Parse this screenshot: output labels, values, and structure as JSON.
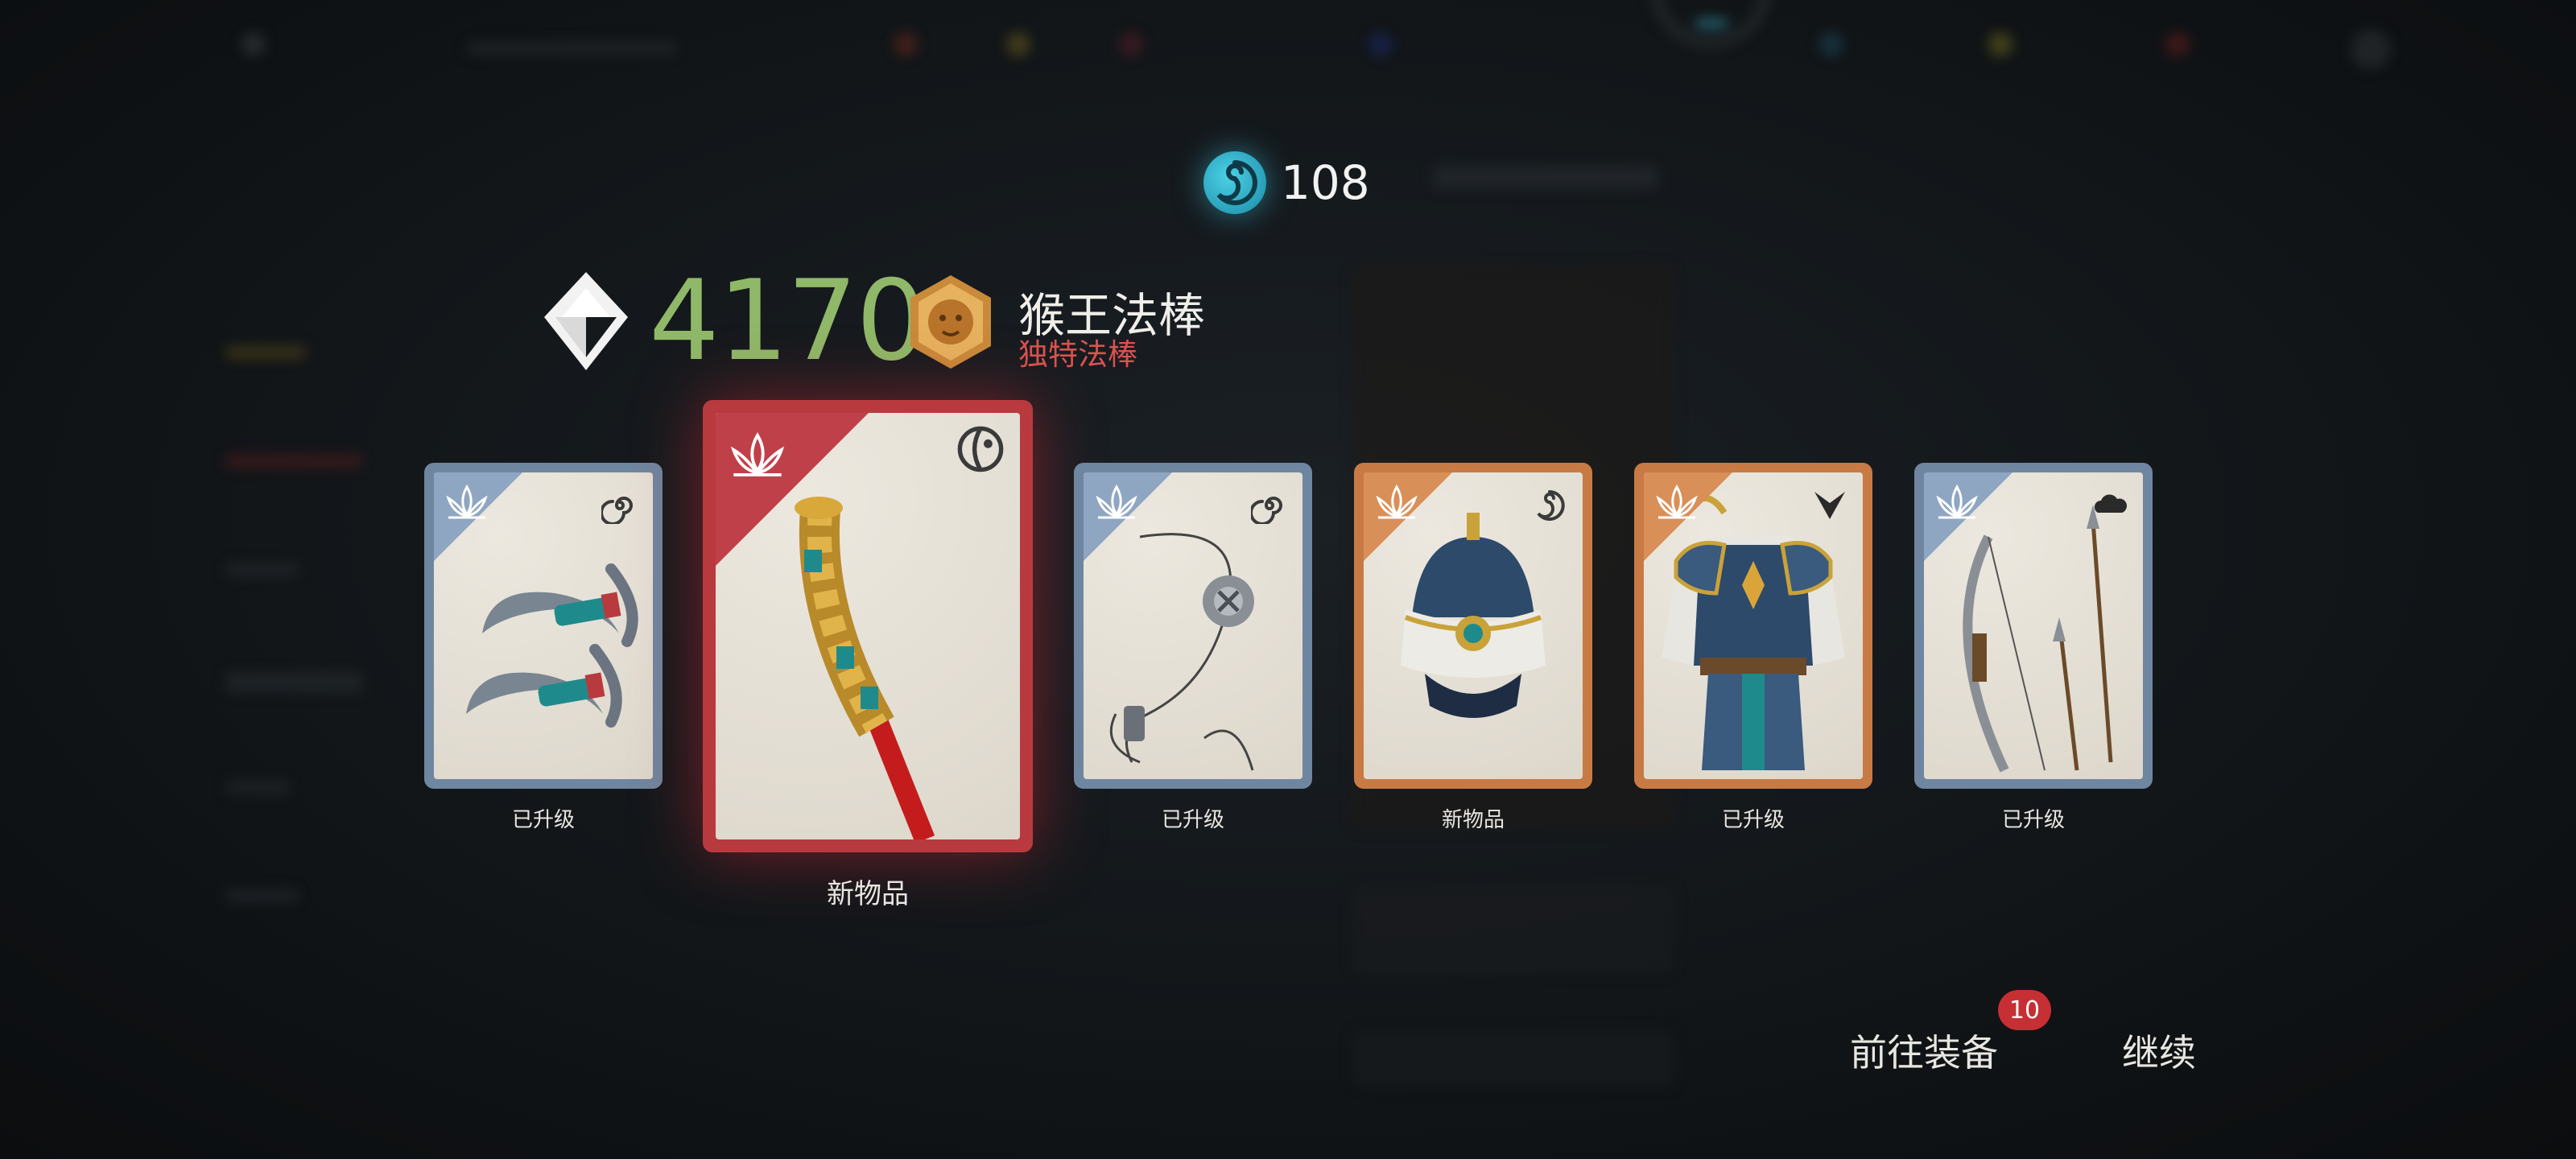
{
  "currency": {
    "icon": "water-swirl-icon",
    "value": "108",
    "color": "#3ec0d8"
  },
  "power": {
    "icon": "power-diamond-icon",
    "value": "4170",
    "color": "#8fb868"
  },
  "featured_item": {
    "badge_icon": "lion-badge-icon",
    "name": "猴王法棒",
    "type": "独特法棒",
    "type_color": "#d9534f"
  },
  "cards": [
    {
      "name": "card-twin-sickles",
      "rarity": "blue",
      "corner_icon": "lotus-icon",
      "element_icon": "wind-spiral-icon",
      "art_icon": "twin-sickles-icon",
      "label": "已升级"
    },
    {
      "name": "card-monkey-staff",
      "rarity": "red",
      "corner_icon": "lotus-icon",
      "element_icon": "yin-yang-icon",
      "art_icon": "golden-staff-icon",
      "label": "新物品"
    },
    {
      "name": "card-rope-dart",
      "rarity": "blue",
      "corner_icon": "lotus-icon",
      "element_icon": "wind-spiral-icon",
      "art_icon": "rope-dart-icon",
      "label": "已升级"
    },
    {
      "name": "card-helmet",
      "rarity": "orange",
      "corner_icon": "lotus-icon",
      "element_icon": "water-swirl-icon",
      "art_icon": "helmet-icon",
      "label": "新物品"
    },
    {
      "name": "card-armor",
      "rarity": "orange",
      "corner_icon": "lotus-icon",
      "element_icon": "chevron-down-icon",
      "art_icon": "armor-icon",
      "label": "已升级"
    },
    {
      "name": "card-bow",
      "rarity": "blue",
      "corner_icon": "lotus-icon",
      "element_icon": "cloud-icon",
      "art_icon": "bow-arrows-icon",
      "label": "已升级"
    }
  ],
  "actions": {
    "equip_label": "前往装备",
    "equip_badge": "10",
    "continue_label": "继续"
  },
  "colors": {
    "rarity_blue": "#6f86a0",
    "rarity_orange": "#c87a45",
    "rarity_red": "#b83a3e",
    "badge_red": "#c62f33"
  }
}
